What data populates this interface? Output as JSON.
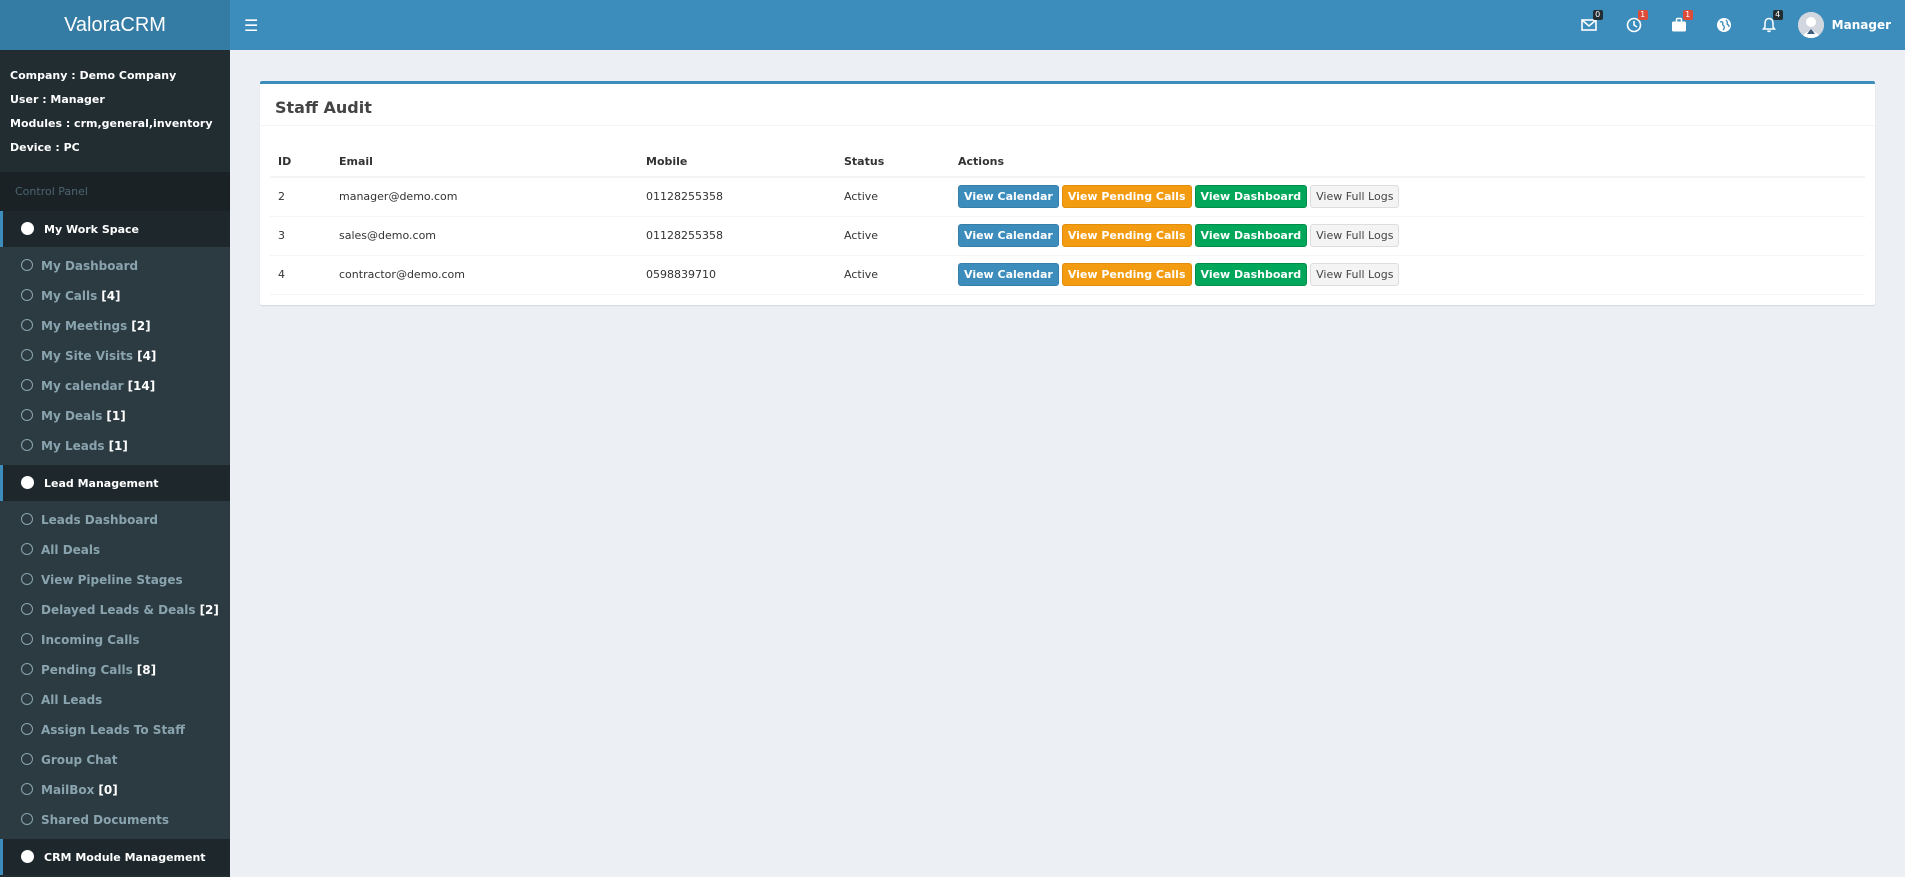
{
  "app": {
    "logo": "ValoraCRM",
    "user_name": "Manager",
    "notifications": {
      "mail": "0",
      "clock": "1",
      "briefcase": "1",
      "bell": "4"
    }
  },
  "sidebar": {
    "info": {
      "company": "Company : Demo Company",
      "user": "User : Manager",
      "modules": "Modules : crm,general,inventory",
      "device": "Device : PC"
    },
    "control_panel": "Control Panel",
    "sections": [
      {
        "title": "My Work Space",
        "items": [
          {
            "label": "My Dashboard",
            "count": ""
          },
          {
            "label": "My Calls",
            "count": "[4]"
          },
          {
            "label": "My Meetings",
            "count": "[2]"
          },
          {
            "label": "My Site Visits",
            "count": "[4]"
          },
          {
            "label": "My calendar",
            "count": "[14]"
          },
          {
            "label": "My Deals",
            "count": "[1]"
          },
          {
            "label": "My Leads",
            "count": "[1]"
          }
        ]
      },
      {
        "title": "Lead Management",
        "items": [
          {
            "label": "Leads Dashboard",
            "count": ""
          },
          {
            "label": "All Deals",
            "count": ""
          },
          {
            "label": "View Pipeline Stages",
            "count": ""
          },
          {
            "label": "Delayed Leads & Deals",
            "count": "[2]"
          },
          {
            "label": "Incoming Calls",
            "count": ""
          },
          {
            "label": "Pending Calls",
            "count": "[8]"
          },
          {
            "label": "All Leads",
            "count": ""
          },
          {
            "label": "Assign Leads To Staff",
            "count": ""
          },
          {
            "label": "Group Chat",
            "count": ""
          },
          {
            "label": "MailBox",
            "count": "[0]"
          },
          {
            "label": "Shared Documents",
            "count": ""
          }
        ]
      },
      {
        "title": "CRM Module Management",
        "items": []
      }
    ]
  },
  "main": {
    "title": "Staff Audit",
    "columns": [
      "ID",
      "Email",
      "Mobile",
      "Status",
      "Actions"
    ],
    "actions": {
      "calendar": "View Calendar",
      "pending": "View Pending Calls",
      "dashboard": "View Dashboard",
      "logs": "View Full Logs"
    },
    "rows": [
      {
        "id": "2",
        "email": "manager@demo.com",
        "mobile": "01128255358",
        "status": "Active"
      },
      {
        "id": "3",
        "email": "sales@demo.com",
        "mobile": "01128255358",
        "status": "Active"
      },
      {
        "id": "4",
        "email": "contractor@demo.com",
        "mobile": "0598839710",
        "status": "Active"
      }
    ]
  },
  "colors": {
    "header": "#3c8dbc",
    "logo_bg": "#357ca5",
    "sidebar": "#222d32",
    "primary": "#3c8dbc",
    "warning": "#f39c12",
    "success": "#00a65a"
  }
}
